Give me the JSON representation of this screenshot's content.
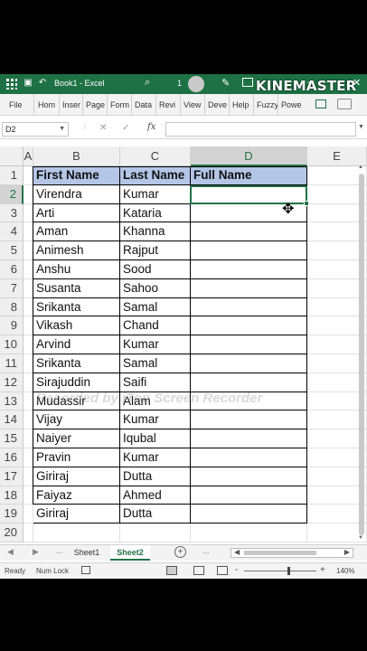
{
  "window": {
    "title": "Book1 - Excel",
    "notification_count": "1"
  },
  "overlay": {
    "brand": "KINEMASTER",
    "recorder": "Recorded by iTop Screen Recorder"
  },
  "ribbon_tabs": [
    "File",
    "Hom",
    "Inser",
    "Page",
    "Form",
    "Data",
    "Revi",
    "View",
    "Deve",
    "Help",
    "Fuzzy",
    "Powe"
  ],
  "formula_bar": {
    "name_box": "D2",
    "cancel": "✕",
    "enter": "✓",
    "fx": "fx",
    "value": ""
  },
  "columns": [
    "A",
    "B",
    "C",
    "D",
    "E"
  ],
  "rows": [
    "1",
    "2",
    "3",
    "4",
    "5",
    "6",
    "7",
    "8",
    "9",
    "10",
    "11",
    "12",
    "13",
    "14",
    "15",
    "16",
    "17",
    "18",
    "19",
    "20"
  ],
  "table": {
    "headers": {
      "first": "First Name",
      "last": "Last Name",
      "full": "Full Name"
    },
    "people": [
      {
        "first": "Virendra",
        "last": "Kumar"
      },
      {
        "first": "Arti",
        "last": "Kataria"
      },
      {
        "first": "Aman",
        "last": "Khanna"
      },
      {
        "first": "Animesh",
        "last": "Rajput"
      },
      {
        "first": "Anshu",
        "last": "Sood"
      },
      {
        "first": "Susanta",
        "last": "Sahoo"
      },
      {
        "first": "Srikanta",
        "last": "Samal"
      },
      {
        "first": "Vikash",
        "last": "Chand"
      },
      {
        "first": "Arvind",
        "last": "Kumar"
      },
      {
        "first": "Srikanta",
        "last": "Samal"
      },
      {
        "first": "Sirajuddin",
        "last": "Saifi"
      },
      {
        "first": "Mudassir",
        "last": "Alam"
      },
      {
        "first": "Vijay",
        "last": "Kumar"
      },
      {
        "first": "Naiyer",
        "last": "Iqubal"
      },
      {
        "first": "Pravin",
        "last": "Kumar"
      },
      {
        "first": "Giriraj",
        "last": "Dutta"
      },
      {
        "first": "Faiyaz",
        "last": "Ahmed"
      },
      {
        "first": "Giriraj",
        "last": "Dutta"
      }
    ]
  },
  "sheets": {
    "tabs": [
      "Sheet1",
      "Sheet2"
    ],
    "active": "Sheet2",
    "add": "+",
    "more": "..."
  },
  "status": {
    "ready": "Ready",
    "num_lock": "Num Lock",
    "zoom_out": "-",
    "zoom_in": "+",
    "zoom": "140%"
  },
  "colors": {
    "excel_green": "#217346",
    "title_green": "#1e7145",
    "header_fill": "#b4c6e7"
  }
}
